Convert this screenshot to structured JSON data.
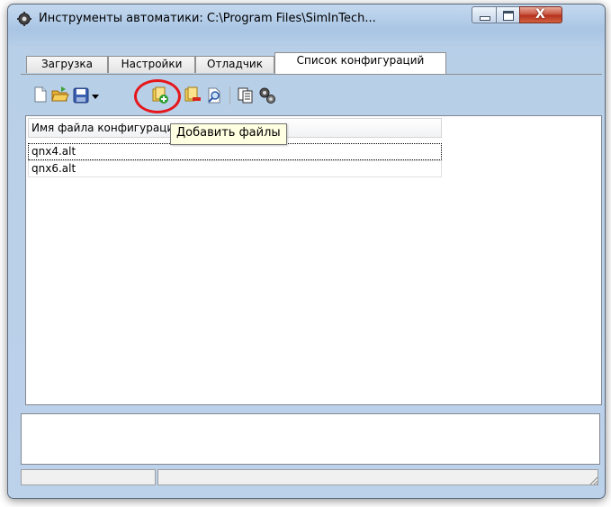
{
  "window": {
    "title": "Инструменты автоматики: C:\\Program Files\\SimInTech...",
    "close_label": "X"
  },
  "tabs": [
    {
      "label": "Загрузка",
      "active": false
    },
    {
      "label": "Настройки",
      "active": false
    },
    {
      "label": "Отладчик",
      "active": false
    },
    {
      "label": "Список конфигураций",
      "active": true
    }
  ],
  "toolbar": {
    "buttons": [
      {
        "icon": "new-file-icon"
      },
      {
        "icon": "open-folder-icon"
      },
      {
        "icon": "save-icon"
      },
      {
        "icon": "dropdown-arrow-icon"
      },
      {
        "icon": "add-files-icon"
      },
      {
        "icon": "remove-files-icon"
      },
      {
        "icon": "search-file-icon"
      },
      {
        "icon": "copy-icon"
      },
      {
        "icon": "settings-gears-icon"
      }
    ],
    "tooltip": "Добавить файлы"
  },
  "config_list": {
    "column_header": "Имя файла конфигурации",
    "rows": [
      "qnx4.alt",
      "qnx6.alt"
    ]
  },
  "colors": {
    "highlight": "#e6171c",
    "tooltip_bg": "#ffffe1"
  }
}
